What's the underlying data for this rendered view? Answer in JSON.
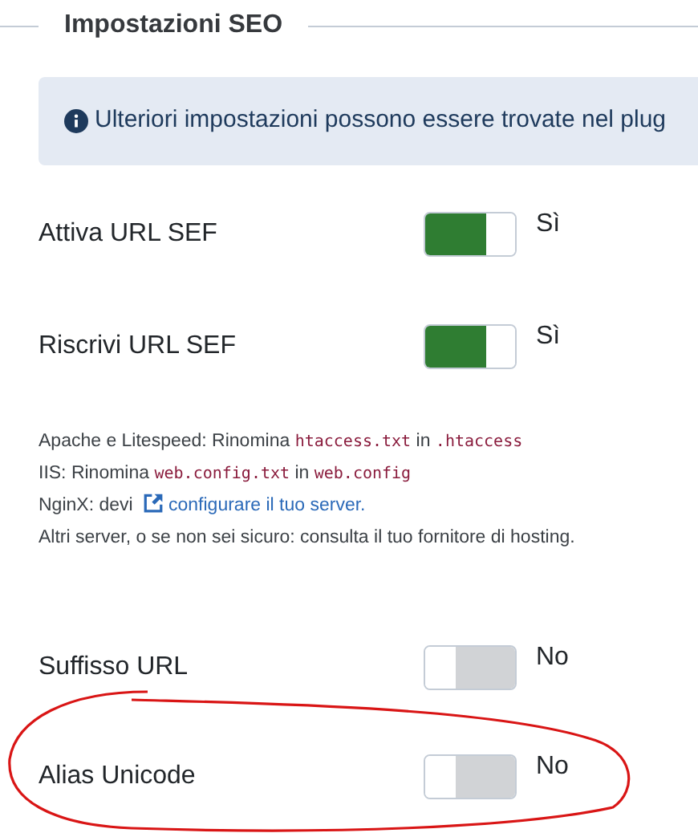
{
  "fieldset": {
    "legend": "Impostazioni SEO"
  },
  "info": {
    "text": "Ulteriori impostazioni possono essere trovate nel plug"
  },
  "settings_top": [
    {
      "label": "Attiva URL SEF",
      "on": true,
      "value": "Sì"
    },
    {
      "label": "Riscrivi URL SEF",
      "on": true,
      "value": "Sì"
    }
  ],
  "help": [
    [
      {
        "kind": "text",
        "text": "Apache e Litespeed: Rinomina "
      },
      {
        "kind": "code",
        "text": "htaccess.txt"
      },
      {
        "kind": "text",
        "text": " in "
      },
      {
        "kind": "code",
        "text": ".htaccess"
      }
    ],
    [
      {
        "kind": "text",
        "text": "IIS: Rinomina "
      },
      {
        "kind": "code",
        "text": "web.config.txt"
      },
      {
        "kind": "text",
        "text": " in "
      },
      {
        "kind": "code",
        "text": "web.config"
      }
    ],
    [
      {
        "kind": "text",
        "text": "NginX: devi "
      },
      {
        "kind": "link",
        "text": "configurare il tuo server."
      }
    ],
    [
      {
        "kind": "text",
        "text": "Altri server, o se non sei sicuro: consulta il tuo fornitore di hosting."
      }
    ]
  ],
  "settings_bottom": [
    {
      "label": "Suffisso URL",
      "on": false,
      "value": "No"
    },
    {
      "label": "Alias Unicode",
      "on": false,
      "value": "No"
    }
  ]
}
